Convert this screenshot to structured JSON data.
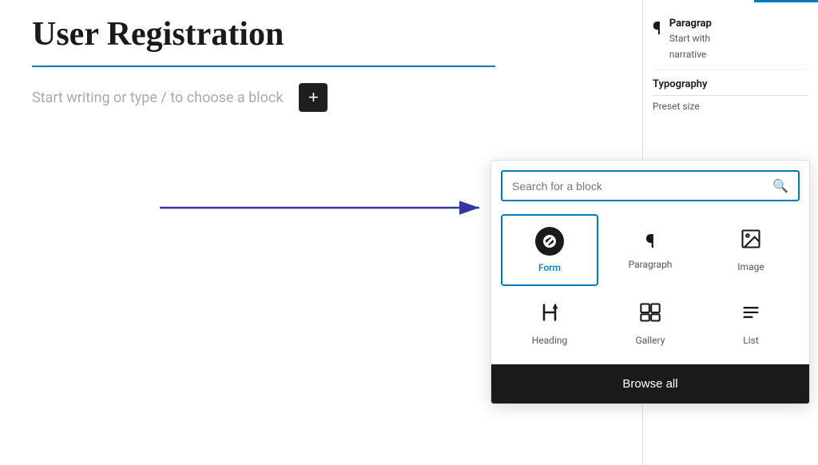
{
  "page": {
    "title": "User Registration",
    "placeholder": "Start writing or type / to choose a block"
  },
  "right_panel": {
    "paragraph_title": "Paragrap",
    "paragraph_desc_line1": "Start with",
    "paragraph_desc_line2": "narrative",
    "typography_label": "Typography",
    "preset_size_label": "Preset size"
  },
  "block_inserter": {
    "search_placeholder": "Search for a block",
    "blocks": [
      {
        "id": "form",
        "label": "Form",
        "icon": "form"
      },
      {
        "id": "paragraph",
        "label": "Paragraph",
        "icon": "paragraph"
      },
      {
        "id": "image",
        "label": "Image",
        "icon": "image"
      },
      {
        "id": "heading",
        "label": "Heading",
        "icon": "heading"
      },
      {
        "id": "gallery",
        "label": "Gallery",
        "icon": "gallery"
      },
      {
        "id": "list",
        "label": "List",
        "icon": "list"
      }
    ],
    "browse_all_label": "Browse all"
  },
  "toolbar": {
    "add_block_label": "+"
  }
}
